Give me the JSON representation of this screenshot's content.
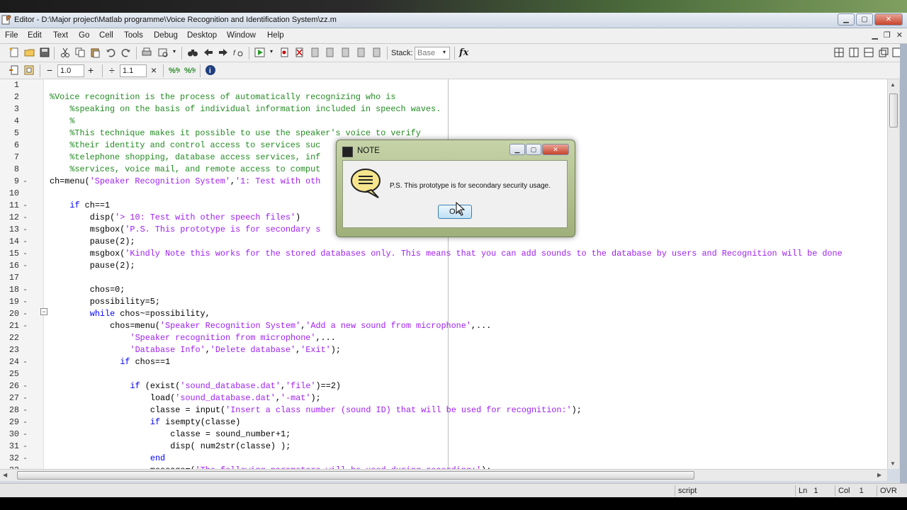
{
  "window": {
    "title": "Editor - D:\\Major project\\Matlab programme\\Voice Recognition and Identification System\\zz.m",
    "buttons": [
      "minimize",
      "maximize",
      "close"
    ]
  },
  "menubar": {
    "items": [
      "File",
      "Edit",
      "Text",
      "Go",
      "Cell",
      "Tools",
      "Debug",
      "Desktop",
      "Window",
      "Help"
    ]
  },
  "toolbar1": {
    "stack_label": "Stack:",
    "stack_value": "Base",
    "fx_label": "fx"
  },
  "toolbar2": {
    "minus": "−",
    "value1": "1.0",
    "plus": "+",
    "divide": "÷",
    "value2": "1.1",
    "times": "×"
  },
  "code": {
    "lines": [
      {
        "n": "1",
        "mark": "",
        "text": ""
      },
      {
        "n": "2",
        "mark": "",
        "text": "%Voice recognition is the process of automatically recognizing who is"
      },
      {
        "n": "3",
        "mark": "",
        "text": "    %speaking on the basis of individual information included in speech waves."
      },
      {
        "n": "4",
        "mark": "",
        "text": "    %"
      },
      {
        "n": "5",
        "mark": "",
        "text": "    %This technique makes it possible to use the speaker's voice to verify"
      },
      {
        "n": "6",
        "mark": "",
        "text": "    %their identity and control access to services suc"
      },
      {
        "n": "7",
        "mark": "",
        "text": "    %telephone shopping, database access services, inf"
      },
      {
        "n": "8",
        "mark": "",
        "text": "    %services, voice mail, and remote access to comput"
      },
      {
        "n": "9",
        "mark": "-",
        "text": "ch=menu('Speaker Recognition System','1: Test with oth"
      },
      {
        "n": "10",
        "mark": "",
        "text": ""
      },
      {
        "n": "11",
        "mark": "-",
        "text": "    if ch==1"
      },
      {
        "n": "12",
        "mark": "-",
        "text": "        disp('> 10: Test with other speech files')"
      },
      {
        "n": "13",
        "mark": "-",
        "text": "        msgbox('P.S. This prototype is for secondary s"
      },
      {
        "n": "14",
        "mark": "-",
        "text": "        pause(2);"
      },
      {
        "n": "15",
        "mark": "-",
        "text": "        msgbox('Kindly Note this works for the stored databases only. This means that you can add sounds to the database by users and Recognition will be done"
      },
      {
        "n": "16",
        "mark": "-",
        "text": "        pause(2);"
      },
      {
        "n": "17",
        "mark": "",
        "text": ""
      },
      {
        "n": "18",
        "mark": "-",
        "text": "        chos=0;"
      },
      {
        "n": "19",
        "mark": "-",
        "text": "        possibility=5;"
      },
      {
        "n": "20",
        "mark": "-",
        "text": "        while chos~=possibility,"
      },
      {
        "n": "21",
        "mark": "-",
        "text": "            chos=menu('Speaker Recognition System','Add a new sound from microphone',..."
      },
      {
        "n": "22",
        "mark": "",
        "text": "                'Speaker recognition from microphone',..."
      },
      {
        "n": "23",
        "mark": "",
        "text": "                'Database Info','Delete database','Exit');"
      },
      {
        "n": "24",
        "mark": "-",
        "text": "              if chos==1"
      },
      {
        "n": "25",
        "mark": "",
        "text": ""
      },
      {
        "n": "26",
        "mark": "-",
        "text": "                if (exist('sound_database.dat','file')==2)"
      },
      {
        "n": "27",
        "mark": "-",
        "text": "                    load('sound_database.dat','-mat');"
      },
      {
        "n": "28",
        "mark": "-",
        "text": "                    classe = input('Insert a class number (sound ID) that will be used for recognition:');"
      },
      {
        "n": "29",
        "mark": "-",
        "text": "                    if isempty(classe)"
      },
      {
        "n": "30",
        "mark": "-",
        "text": "                        classe = sound_number+1;"
      },
      {
        "n": "31",
        "mark": "-",
        "text": "                        disp( num2str(classe) );"
      },
      {
        "n": "32",
        "mark": "-",
        "text": "                    end"
      },
      {
        "n": "33",
        "mark": "-",
        "text": "                    message=('The following parameters will be used during recording:');"
      }
    ]
  },
  "statusbar": {
    "mode": "script",
    "ln_label": "Ln",
    "ln_value": "1",
    "col_label": "Col",
    "col_value": "1",
    "ovr": "OVR"
  },
  "dialog": {
    "title": "NOTE",
    "message": "P.S. This prototype is for secondary security usage.",
    "ok_label": "OK"
  }
}
